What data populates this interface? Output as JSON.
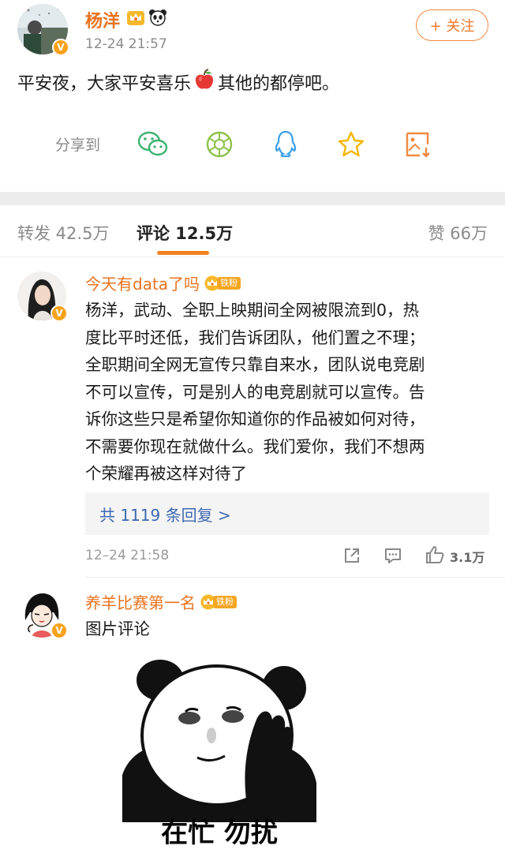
{
  "post": {
    "author": "杨洋",
    "time": "12-24 21:57",
    "follow_label": "+ 关注",
    "text_before": "平安夜，大家平安喜乐",
    "text_after": "其他的都停吧。",
    "verified_mark": "V"
  },
  "share": {
    "label": "分享到",
    "targets": [
      "wechat-icon",
      "moments-icon",
      "qq-icon",
      "favorite-icon",
      "screenshot-icon"
    ]
  },
  "tabs": {
    "repost": "转发 42.5万",
    "comment": "评论 12.5万",
    "like": "赞 66万"
  },
  "comments": [
    {
      "name": "今天有data了吗",
      "badge": "铁粉",
      "lines": [
        "杨洋，武动、全职上映期间全网被限流到0，热",
        "度比平时还低，我们告诉团队，他们置之不理；",
        "全职期间全网无宣传只靠自来水，团队说电竞剧",
        "不可以宣传，可是别人的电竞剧就可以宣传。告",
        "诉你这些只是希望你知道你的作品被如何对待，",
        "不需要你现在就做什么。我们爱你，我们不想两",
        "个荣耀再被这样对待了"
      ],
      "replies": "共 1119 条回复 >",
      "time": "12–24 21:58",
      "likes": "3.1万"
    },
    {
      "name": "养羊比赛第一名",
      "badge": "铁粉",
      "text": "图片评论",
      "meme_caption": "在忙 勿扰"
    }
  ],
  "colors": {
    "accent": "#e8731e",
    "link": "#3d69b1",
    "muted": "#8a8a8a",
    "band": "#ececec"
  }
}
